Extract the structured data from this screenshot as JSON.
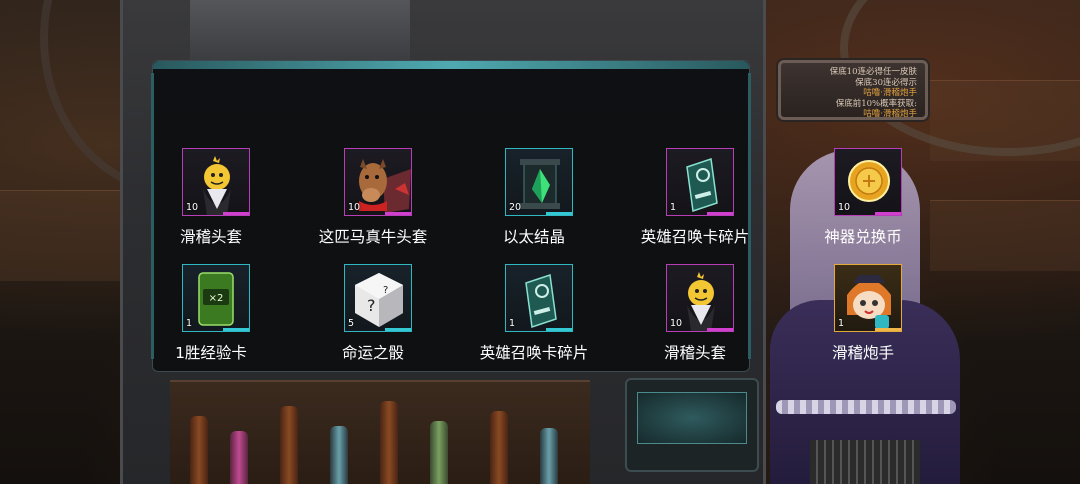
{
  "banner": {
    "lines": [
      "保底10连必得任一皮肤",
      "保底30连必得示",
      "咕噜·滑稽炮手",
      "保底前10%概率获取:",
      "咕噜·滑稽炮手"
    ]
  },
  "rewards": [
    {
      "name": "滑稽头套",
      "count": "10",
      "rarity": "purple",
      "icon": "clown-mask-icon"
    },
    {
      "name": "这匹马真牛头套",
      "count": "10",
      "rarity": "purple",
      "icon": "horse-mask-icon"
    },
    {
      "name": "以太结晶",
      "count": "20",
      "rarity": "teal",
      "icon": "ether-crystal-icon"
    },
    {
      "name": "英雄召唤卡碎片",
      "count": "1",
      "rarity": "purple",
      "icon": "summon-card-fragment-icon"
    },
    {
      "name": "神器兑换币",
      "count": "10",
      "rarity": "purple",
      "icon": "artifact-coin-icon"
    },
    {
      "name": "1胜经验卡",
      "count": "1",
      "rarity": "teal",
      "icon": "exp-card-icon"
    },
    {
      "name": "命运之骰",
      "count": "5",
      "rarity": "teal",
      "icon": "fate-dice-icon"
    },
    {
      "name": "英雄召唤卡碎片",
      "count": "1",
      "rarity": "teal",
      "icon": "summon-card-fragment-icon"
    },
    {
      "name": "滑稽头套",
      "count": "10",
      "rarity": "purple",
      "icon": "clown-mask-icon"
    },
    {
      "name": "滑稽炮手",
      "count": "1",
      "rarity": "gold",
      "icon": "clown-gunner-icon"
    }
  ],
  "colors": {
    "purple": "#b73eb6",
    "teal": "#2fb7c2",
    "gold": "#e3a93a"
  }
}
